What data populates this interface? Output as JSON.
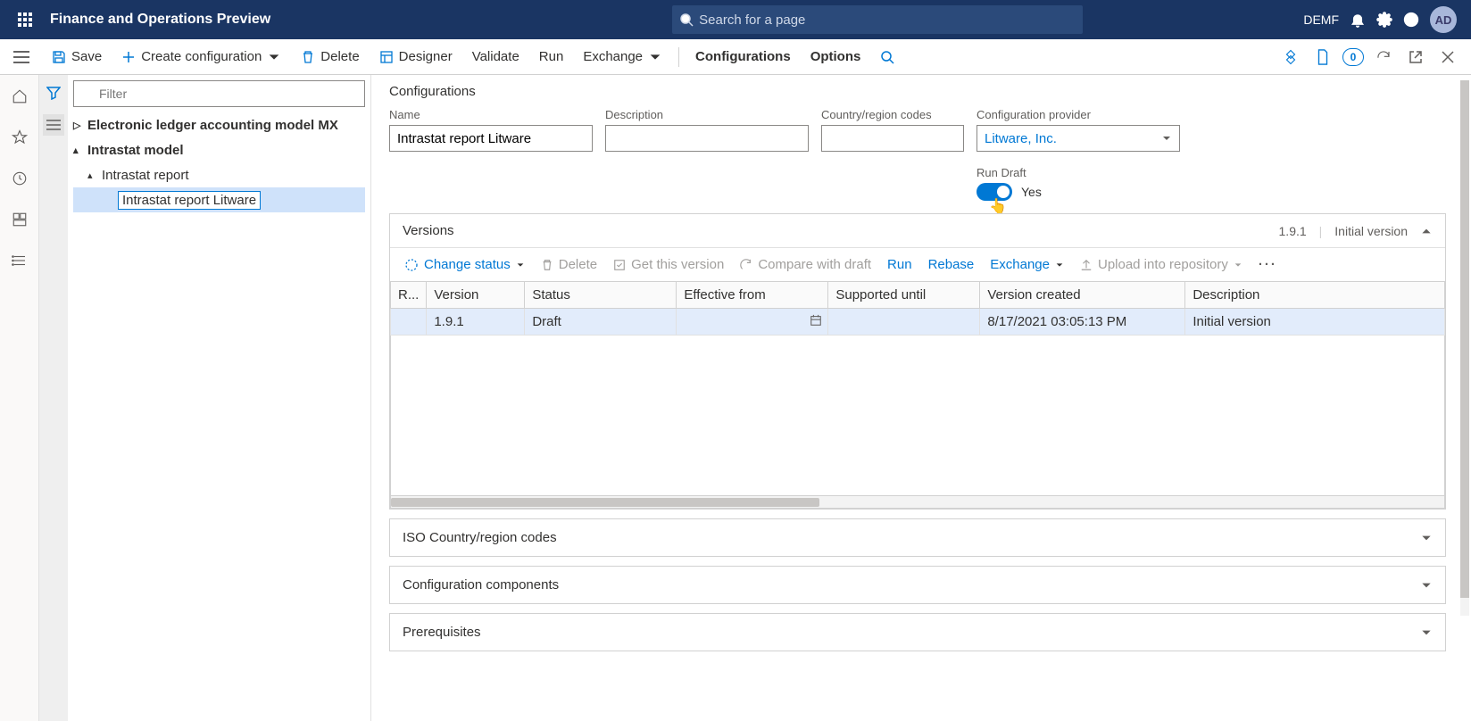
{
  "topbar": {
    "app_title": "Finance and Operations Preview",
    "search_placeholder": "Search for a page",
    "company": "DEMF",
    "avatar": "AD"
  },
  "actionbar": {
    "save": "Save",
    "create_config": "Create configuration",
    "delete": "Delete",
    "designer": "Designer",
    "validate": "Validate",
    "run": "Run",
    "exchange": "Exchange",
    "configurations": "Configurations",
    "options": "Options",
    "badge_count": "0"
  },
  "nav": {
    "filter_placeholder": "Filter",
    "items": [
      {
        "label": "Electronic ledger accounting model MX",
        "bold": true,
        "indent": 0,
        "expand": "right"
      },
      {
        "label": "Intrastat model",
        "bold": true,
        "indent": 0,
        "expand": "down"
      },
      {
        "label": "Intrastat report",
        "bold": false,
        "indent": 1,
        "expand": "down"
      },
      {
        "label": "Intrastat report Litware",
        "bold": false,
        "indent": 2,
        "selected": true
      }
    ]
  },
  "page": {
    "title": "Configurations",
    "fields": {
      "name_label": "Name",
      "name_value": "Intrastat report Litware",
      "desc_label": "Description",
      "desc_value": "",
      "country_label": "Country/region codes",
      "country_value": "",
      "provider_label": "Configuration provider",
      "provider_value": "Litware, Inc.",
      "rundraft_label": "Run Draft",
      "rundraft_value": "Yes"
    }
  },
  "versions": {
    "title": "Versions",
    "summary_version": "1.9.1",
    "summary_desc": "Initial version",
    "toolbar": {
      "change_status": "Change status",
      "delete": "Delete",
      "get_version": "Get this version",
      "compare": "Compare with draft",
      "run": "Run",
      "rebase": "Rebase",
      "exchange": "Exchange",
      "upload": "Upload into repository"
    },
    "columns": {
      "r": "R...",
      "version": "Version",
      "status": "Status",
      "effective": "Effective from",
      "supported": "Supported until",
      "created": "Version created",
      "description": "Description"
    },
    "rows": [
      {
        "r": "",
        "version": "1.9.1",
        "status": "Draft",
        "effective": "",
        "supported": "",
        "created": "8/17/2021 03:05:13 PM",
        "description": "Initial version"
      }
    ]
  },
  "sections": {
    "iso": "ISO Country/region codes",
    "components": "Configuration components",
    "prereq": "Prerequisites"
  }
}
